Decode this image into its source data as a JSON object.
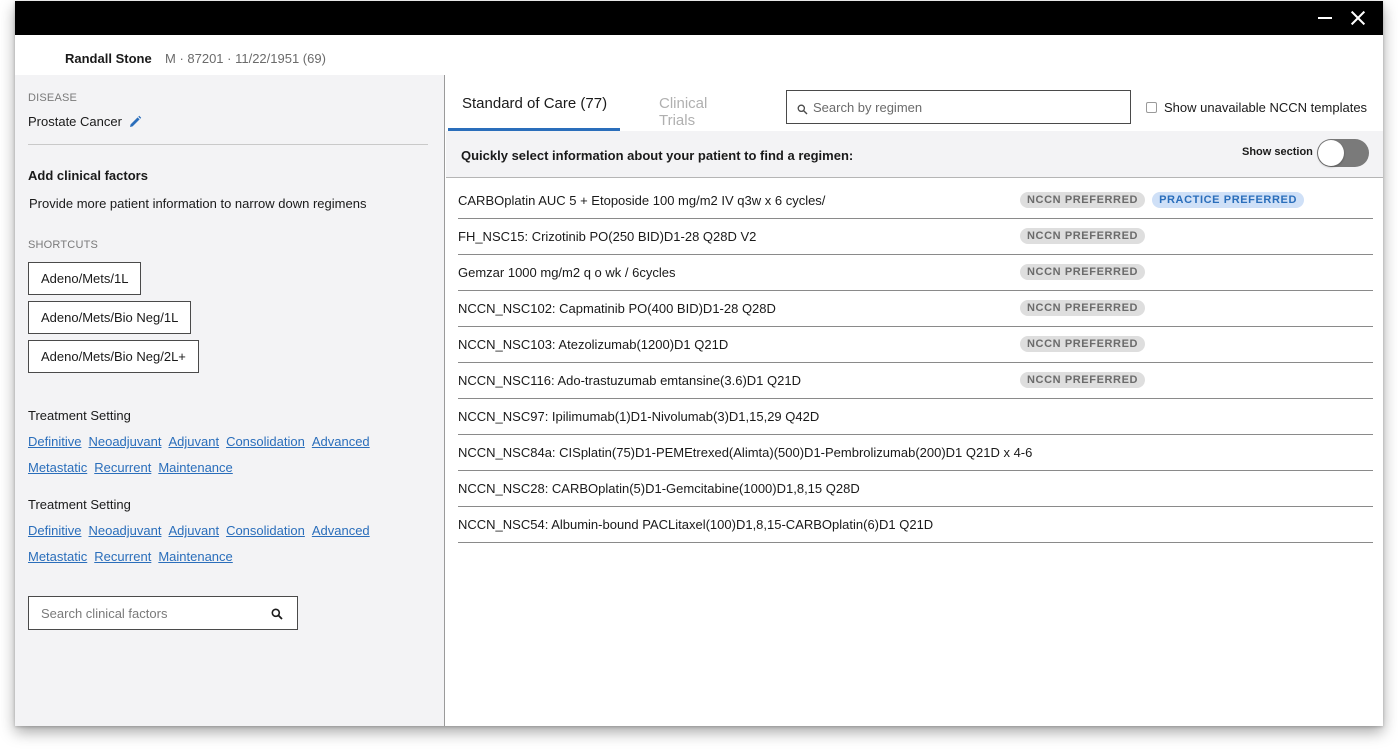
{
  "window": {
    "minimize_icon": "minimize-icon",
    "close_icon": "close-icon"
  },
  "patient": {
    "name": "Randall Stone",
    "meta": "M · 87201 · 11/22/1951 (69)"
  },
  "left_panel": {
    "disease_label": "DISEASE",
    "disease_value": "Prostate Cancer",
    "edit_icon": "pencil-icon",
    "add_factors_title": "Add clinical factors",
    "add_factors_desc": "Provide more patient information to narrow down regimens",
    "shortcuts_label": "SHORTCUTS",
    "shortcuts": [
      "Adeno/Mets/1L",
      "Adeno/Mets/Bio Neg/1L",
      "Adeno/Mets/Bio Neg/2L+"
    ],
    "treatment_sections": [
      {
        "title": "Treatment Setting",
        "row1": [
          "Definitive",
          "Neoadjuvant",
          "Adjuvant",
          "Consolidation",
          "Advanced"
        ],
        "row2": [
          "Metastatic",
          "Recurrent",
          "Maintenance"
        ]
      },
      {
        "title": "Treatment Setting",
        "row1": [
          "Definitive",
          "Neoadjuvant",
          "Adjuvant",
          "Consolidation",
          "Advanced"
        ],
        "row2": [
          "Metastatic",
          "Recurrent",
          "Maintenance"
        ]
      }
    ],
    "search_placeholder": "Search clinical factors",
    "search_icon": "search-icon"
  },
  "right_panel": {
    "tabs": [
      {
        "label": "Standard of Care (77)",
        "active": true
      },
      {
        "label": "Clinical Trials",
        "active": false
      }
    ],
    "search_placeholder": "Search by regimen",
    "search_icon": "search-icon",
    "unavailable_label": "Show unavailable NCCN templates",
    "unavailable_checked": false,
    "quick_select_text": "Quickly select information about your patient to find a regimen:",
    "show_section_label": "Show section",
    "show_section_on": false,
    "colors": {
      "accent": "#2a6ebb",
      "badge_gray": "#dedede",
      "badge_blue": "#cfe0f7"
    },
    "regimens": [
      {
        "name": "CARBOplatin AUC 5 + Etoposide 100 mg/m2 IV q3w x 6 cycles/",
        "badges": [
          "NCCN PREFERRED",
          "PRACTICE PREFERRED"
        ]
      },
      {
        "name": "FH_NSC15: Crizotinib PO(250 BID)D1-28 Q28D V2",
        "badges": [
          "NCCN PREFERRED"
        ]
      },
      {
        "name": "Gemzar 1000 mg/m2 q o wk / 6cycles",
        "badges": [
          "NCCN PREFERRED"
        ]
      },
      {
        "name": "NCCN_NSC102: Capmatinib PO(400 BID)D1-28 Q28D",
        "badges": [
          "NCCN PREFERRED"
        ]
      },
      {
        "name": "NCCN_NSC103: Atezolizumab(1200)D1 Q21D",
        "badges": [
          "NCCN PREFERRED"
        ]
      },
      {
        "name": "NCCN_NSC116: Ado-trastuzumab emtansine(3.6)D1 Q21D",
        "badges": [
          "NCCN PREFERRED"
        ]
      },
      {
        "name": "NCCN_NSC97: Ipilimumab(1)D1-Nivolumab(3)D1,15,29 Q42D",
        "badges": []
      },
      {
        "name": "NCCN_NSC84a: CISplatin(75)D1-PEMEtrexed(Alimta)(500)D1-Pembrolizumab(200)D1 Q21D x 4-6",
        "badges": []
      },
      {
        "name": "NCCN_NSC28: CARBOplatin(5)D1-Gemcitabine(1000)D1,8,15 Q28D",
        "badges": []
      },
      {
        "name": "NCCN_NSC54: Albumin-bound PACLitaxel(100)D1,8,15-CARBOplatin(6)D1 Q21D",
        "badges": []
      }
    ]
  }
}
